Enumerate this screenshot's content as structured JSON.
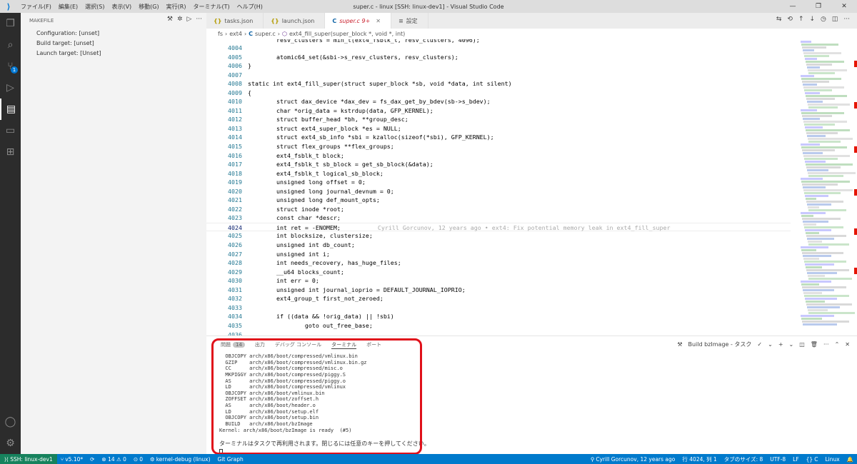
{
  "titlebar": {
    "menu": [
      "ファイル(F)",
      "編集(E)",
      "選択(S)",
      "表示(V)",
      "移動(G)",
      "実行(R)",
      "ターミナル(T)",
      "ヘルプ(H)"
    ],
    "title": "super.c - linux [SSH: linux-dev1] - Visual Studio Code"
  },
  "sidebar": {
    "header": "MAKEFILE",
    "items": [
      "Configuration: [unset]",
      "Build target: [unset]",
      "Launch target: [Unset]"
    ]
  },
  "activity": {
    "scm_badge": "1"
  },
  "tabs": [
    {
      "label": "tasks.json",
      "icon": "{}"
    },
    {
      "label": "launch.json",
      "icon": "{}"
    },
    {
      "label": "super.c 9+",
      "icon": "C"
    },
    {
      "label": "設定",
      "icon": "≡"
    }
  ],
  "breadcrumb": [
    "fs",
    "ext4",
    "super.c",
    "ext4_fill_super(super_block *, void *, int)"
  ],
  "code": {
    "partial_top": "        resv_clusters = min_t(ext4_fsblk_t, resv_clusters, 4096);",
    "lines": [
      {
        "n": "4004",
        "t": ""
      },
      {
        "n": "4005",
        "t": "        atomic64_set(&sbi->s_resv_clusters, resv_clusters);"
      },
      {
        "n": "4006",
        "t": "}"
      },
      {
        "n": "4007",
        "t": ""
      },
      {
        "n": "4008",
        "t": "static int ext4_fill_super(struct super_block *sb, void *data, int silent)"
      },
      {
        "n": "4009",
        "t": "{"
      },
      {
        "n": "4010",
        "t": "        struct dax_device *dax_dev = fs_dax_get_by_bdev(sb->s_bdev);"
      },
      {
        "n": "4011",
        "t": "        char *orig_data = kstrdup(data, GFP_KERNEL);"
      },
      {
        "n": "4012",
        "t": "        struct buffer_head *bh, **group_desc;"
      },
      {
        "n": "4013",
        "t": "        struct ext4_super_block *es = NULL;"
      },
      {
        "n": "4014",
        "t": "        struct ext4_sb_info *sbi = kzalloc(sizeof(*sbi), GFP_KERNEL);"
      },
      {
        "n": "4015",
        "t": "        struct flex_groups **flex_groups;"
      },
      {
        "n": "4016",
        "t": "        ext4_fsblk_t block;"
      },
      {
        "n": "4017",
        "t": "        ext4_fsblk_t sb_block = get_sb_block(&data);"
      },
      {
        "n": "4018",
        "t": "        ext4_fsblk_t logical_sb_block;"
      },
      {
        "n": "4019",
        "t": "        unsigned long offset = 0;"
      },
      {
        "n": "4020",
        "t": "        unsigned long journal_devnum = 0;"
      },
      {
        "n": "4021",
        "t": "        unsigned long def_mount_opts;"
      },
      {
        "n": "4022",
        "t": "        struct inode *root;"
      },
      {
        "n": "4023",
        "t": "        const char *descr;"
      },
      {
        "n": "4024",
        "t": "        int ret = -ENOMEM;",
        "blame": "Cyrill Gorcunov, 12 years ago • ext4: Fix potential memory leak in ext4_fill_super"
      },
      {
        "n": "4025",
        "t": "        int blocksize, clustersize;"
      },
      {
        "n": "4026",
        "t": "        unsigned int db_count;"
      },
      {
        "n": "4027",
        "t": "        unsigned int i;"
      },
      {
        "n": "4028",
        "t": "        int needs_recovery, has_huge_files;"
      },
      {
        "n": "4029",
        "t": "        __u64 blocks_count;"
      },
      {
        "n": "4030",
        "t": "        int err = 0;"
      },
      {
        "n": "4031",
        "t": "        unsigned int journal_ioprio = DEFAULT_JOURNAL_IOPRIO;"
      },
      {
        "n": "4032",
        "t": "        ext4_group_t first_not_zeroed;"
      },
      {
        "n": "4033",
        "t": ""
      },
      {
        "n": "4034",
        "t": "        if ((data && !orig_data) || !sbi)"
      },
      {
        "n": "4035",
        "t": "                goto out_free_base;"
      },
      {
        "n": "4036",
        "t": ""
      }
    ]
  },
  "panel": {
    "tabs": [
      {
        "label": "問題",
        "count": "14"
      },
      {
        "label": "出力"
      },
      {
        "label": "デバッグ コンソール"
      },
      {
        "label": "ターミナル",
        "active": true
      },
      {
        "label": "ポート"
      }
    ],
    "task_label": "Build bzImage - タスク",
    "terminal_lines": [
      "  OBJCOPY arch/x86/boot/compressed/vmlinux.bin",
      "  GZIP    arch/x86/boot/compressed/vmlinux.bin.gz",
      "  CC      arch/x86/boot/compressed/misc.o",
      "  MKPIGGY arch/x86/boot/compressed/piggy.S",
      "  AS      arch/x86/boot/compressed/piggy.o",
      "  LD      arch/x86/boot/compressed/vmlinux",
      "  OBJCOPY arch/x86/boot/vmlinux.bin",
      "  ZOFFSET arch/x86/boot/zoffset.h",
      "  AS      arch/x86/boot/header.o",
      "  LD      arch/x86/boot/setup.elf",
      "  OBJCOPY arch/x86/boot/setup.bin",
      "  BUILD   arch/x86/boot/bzImage",
      "Kernel: arch/x86/boot/bzImage is ready  (#5)"
    ],
    "final_message": "ターミナルはタスクで再利用されます。閉じるには任意のキーを押してください。"
  },
  "status": {
    "remote": "SSH: linux-dev1",
    "branch": "v5.10*",
    "problems": "⊗ 14 ⚠ 0",
    "ports": "0",
    "debug": "kernel-debug (linux)",
    "gitgraph": "Git Graph",
    "blame": "Cyrill Gorcunov, 12 years ago",
    "position": "行 4024, 列 1",
    "tabsize": "タブのサイズ: 8",
    "encoding": "UTF-8",
    "eol": "LF",
    "lang": "C",
    "os": "Linux"
  }
}
